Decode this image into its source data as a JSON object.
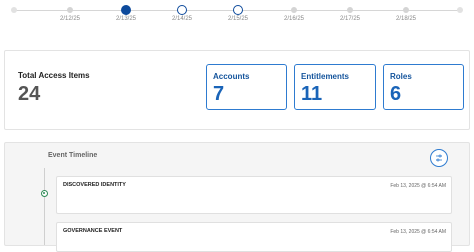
{
  "stepper": {
    "steps": [
      {
        "label": "2/12/25",
        "state": "future"
      },
      {
        "label": "2/13/25",
        "state": "current"
      },
      {
        "label": "2/14/25",
        "state": "hollow"
      },
      {
        "label": "2/15/25",
        "state": "hollow"
      },
      {
        "label": "2/16/25",
        "state": "future"
      },
      {
        "label": "2/17/25",
        "state": "future"
      },
      {
        "label": "2/18/25",
        "state": "future"
      }
    ]
  },
  "summary": {
    "total_label": "Total Access Items",
    "total_value": "24",
    "stats": [
      {
        "label": "Accounts",
        "value": "7"
      },
      {
        "label": "Entitlements",
        "value": "11"
      },
      {
        "label": "Roles",
        "value": "6"
      }
    ]
  },
  "timeline": {
    "title": "Event Timeline",
    "filter_icon": "sliders-icon",
    "events": [
      {
        "title": "DISCOVERED IDENTITY",
        "time": "Feb 13, 2025 @ 6:54 AM"
      },
      {
        "title": "GOVERNANCE EVENT",
        "time": "Feb 13, 2025 @ 6:54 AM"
      }
    ]
  },
  "colors": {
    "accent": "#0d4a9c",
    "stat_border": "#2e7bd0",
    "stat_text": "#1a64b8",
    "timeline_marker": "#2e8b57"
  }
}
